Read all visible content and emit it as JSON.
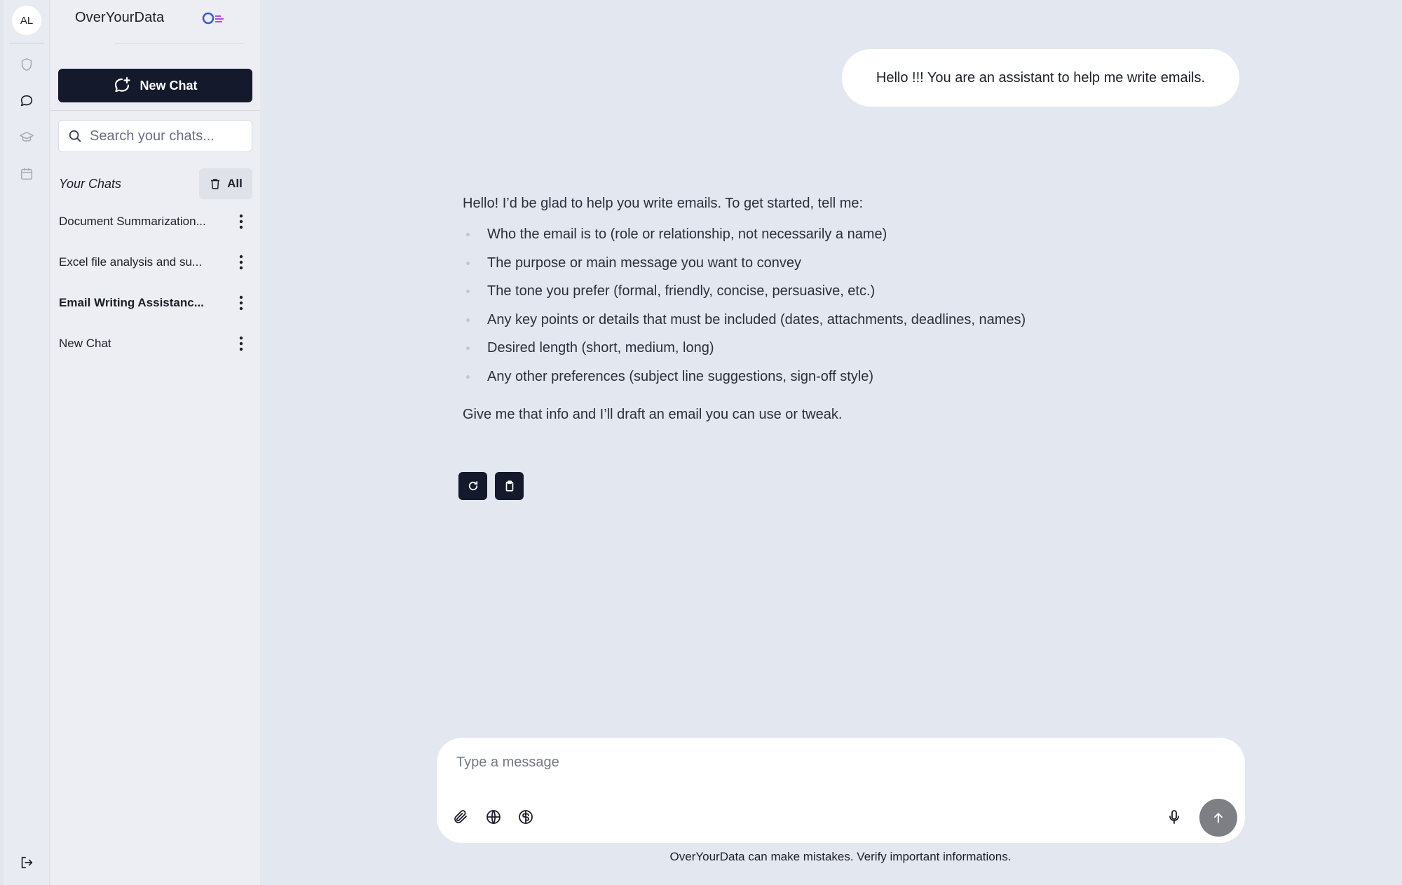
{
  "rail": {
    "avatar_initials": "AL",
    "icons": [
      "shield-icon",
      "chat-bubble-icon",
      "graduation-cap-icon",
      "calendar-icon",
      "logout-icon"
    ]
  },
  "sidebar": {
    "brand": "OverYourData",
    "new_chat_label": "New Chat",
    "search_placeholder": "Search your chats...",
    "your_chats_label": "Your Chats",
    "delete_all_label": "All",
    "chats": [
      {
        "label": "Document Summarization...",
        "active": false
      },
      {
        "label": "Excel file analysis and su...",
        "active": false
      },
      {
        "label": "Email Writing Assistanc...",
        "active": true
      },
      {
        "label": "New Chat",
        "active": false
      }
    ]
  },
  "conversation": {
    "user_message": "Hello !!! You are an assistant to help me write emails.",
    "assistant": {
      "intro": "Hello! I’d be glad to help you write emails. To get started, tell me:",
      "bullets": [
        "Who the email is to (role or relationship, not necessarily a name)",
        "The purpose or main message you want to convey",
        "The tone you prefer (formal, friendly, concise, persuasive, etc.)",
        "Any key points or details that must be included (dates, attachments, deadlines, names)",
        "Desired length (short, medium, long)",
        "Any other preferences (subject line suggestions, sign-off style)"
      ],
      "closing": "Give me that info and I’ll draft an email you can use or tweak."
    }
  },
  "composer": {
    "placeholder": "Type a message",
    "disclaimer": "OverYourData can make mistakes. Verify important informations."
  },
  "colors": {
    "background": "#e3e7ef",
    "sidebar": "#eceef3",
    "primary_button": "#141a2c",
    "send_button": "#7d7f85"
  }
}
